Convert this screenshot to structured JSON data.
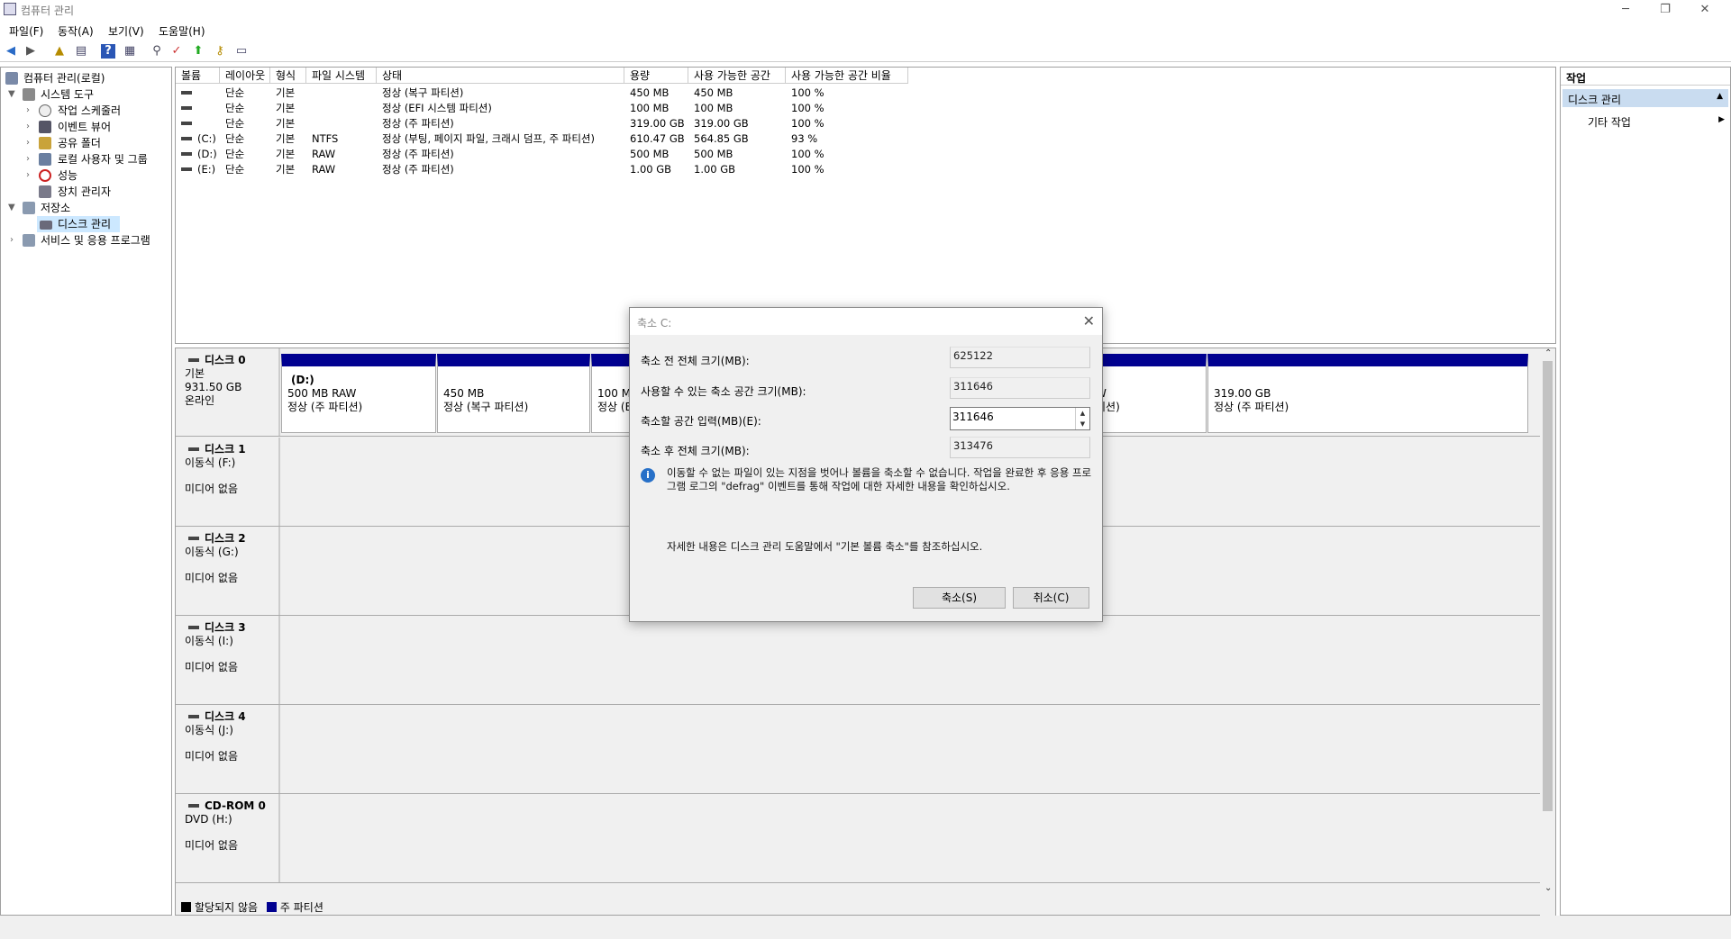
{
  "window": {
    "title": "컴퓨터 관리",
    "minimize": "─",
    "restore": "❐",
    "close": "✕"
  },
  "menu": [
    "파일(F)",
    "동작(A)",
    "보기(V)",
    "도움말(H)"
  ],
  "tree": {
    "root": "컴퓨터 관리(로컬)",
    "system_tools": "시스템 도구",
    "task_scheduler": "작업 스케줄러",
    "event_viewer": "이벤트 뷰어",
    "shared_folders": "공유 폴더",
    "local_users": "로컬 사용자 및 그룹",
    "performance": "성능",
    "device_manager": "장치 관리자",
    "storage": "저장소",
    "disk_management": "디스크 관리",
    "services": "서비스 및 응용 프로그램"
  },
  "volume_table": {
    "headers": [
      "볼륨",
      "레이아웃",
      "형식",
      "파일 시스템",
      "상태",
      "용량",
      "사용 가능한 공간",
      "사용 가능한 공간 비율"
    ],
    "rows": [
      [
        "",
        "단순",
        "기본",
        "",
        "정상 (복구 파티션)",
        "450 MB",
        "450 MB",
        "100 %"
      ],
      [
        "",
        "단순",
        "기본",
        "",
        "정상 (EFI 시스템 파티션)",
        "100 MB",
        "100 MB",
        "100 %"
      ],
      [
        "",
        "단순",
        "기본",
        "",
        "정상 (주 파티션)",
        "319.00 GB",
        "319.00 GB",
        "100 %"
      ],
      [
        "(C:)",
        "단순",
        "기본",
        "NTFS",
        "정상 (부팅, 페이지 파일, 크래시 덤프, 주 파티션)",
        "610.47 GB",
        "564.85 GB",
        "93 %"
      ],
      [
        "(D:)",
        "단순",
        "기본",
        "RAW",
        "정상 (주 파티션)",
        "500 MB",
        "500 MB",
        "100 %"
      ],
      [
        "(E:)",
        "단순",
        "기본",
        "RAW",
        "정상 (주 파티션)",
        "1.00 GB",
        "1.00 GB",
        "100 %"
      ]
    ]
  },
  "disks": {
    "disk0": {
      "name": "디스크 0",
      "type": "기본",
      "size": "931.50 GB",
      "status": "온라인"
    },
    "disk1": {
      "name": "디스크 1",
      "type": "이동식 (F:)",
      "status": "미디어 없음"
    },
    "disk2": {
      "name": "디스크 2",
      "type": "이동식 (G:)",
      "status": "미디어 없음"
    },
    "disk3": {
      "name": "디스크 3",
      "type": "이동식 (I:)",
      "status": "미디어 없음"
    },
    "disk4": {
      "name": "디스크 4",
      "type": "이동식 (J:)",
      "status": "미디어 없음"
    },
    "cdrom0": {
      "name": "CD-ROM 0",
      "type": "DVD (H:)",
      "status": "미디어 없음"
    }
  },
  "partitions": {
    "p1": {
      "label": "(D:)",
      "size": "500 MB RAW",
      "status": "정상 (주 파티션)"
    },
    "p2": {
      "size": "450 MB",
      "status": "정상 (복구 파티션)"
    },
    "p3": {
      "size": "100 M",
      "status": "정상 (E"
    },
    "p4": {
      "size": "W",
      "status": "티션)"
    },
    "p5": {
      "size": "319.00 GB",
      "status": "정상 (주 파티션)"
    }
  },
  "legend": {
    "unallocated": "할당되지 않음",
    "primary": "주 파티션"
  },
  "actions": {
    "title": "작업",
    "section": "디스크 관리",
    "more": "기타 작업"
  },
  "dialog": {
    "title": "축소 C:",
    "total_before_label": "축소 전 전체 크기(MB):",
    "total_before": "625122",
    "available_label": "사용할 수 있는 축소 공간 크기(MB):",
    "available": "311646",
    "amount_label": "축소할 공간 입력(MB)(E):",
    "amount": "311646",
    "total_after_label": "축소 후 전체 크기(MB):",
    "total_after": "313476",
    "info_text": "이동할 수 없는 파일이 있는 지점을 벗어나 볼륨을 축소할 수 없습니다. 작업을 완료한 후 응용 프로그램 로그의 \"defrag\" 이벤트를 통해 작업에 대한 자세한 내용을 확인하십시오.",
    "help_text": "자세한 내용은 디스크 관리 도움말에서 \"기본 볼륨 축소\"를 참조하십시오.",
    "shrink_button": "축소(S)",
    "cancel_button": "취소(C)"
  },
  "colors": {
    "primary_partition": "#000090",
    "unallocated": "#000000",
    "selection": "#cce8ff",
    "actions_header": "#c9dcf0"
  }
}
